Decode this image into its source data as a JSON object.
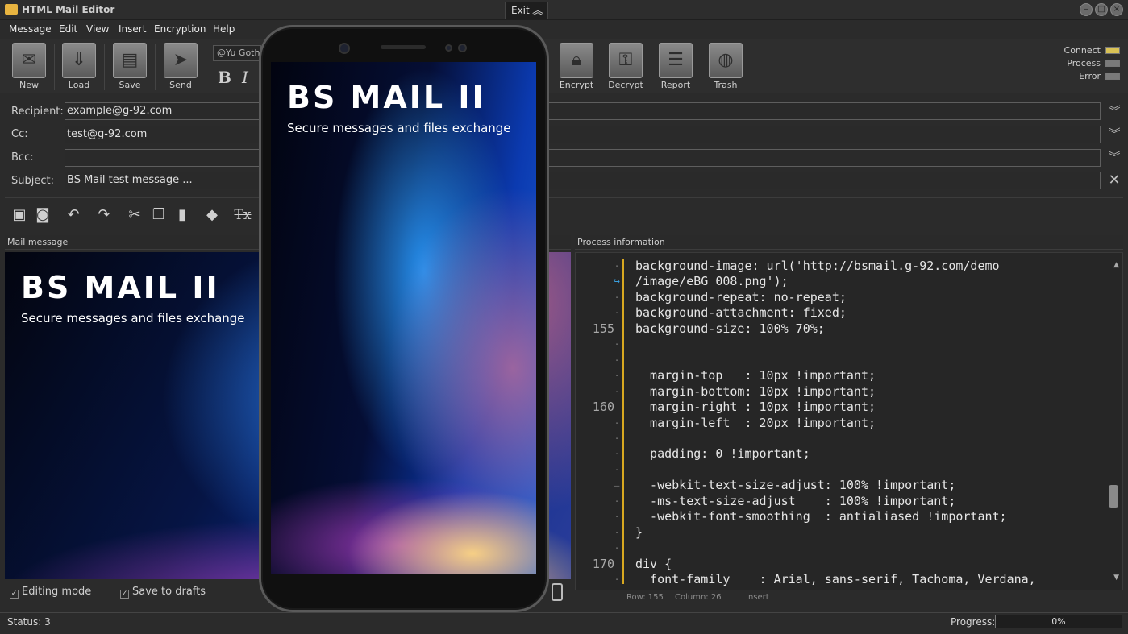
{
  "window": {
    "title": "HTML Mail Editor",
    "exit_label": "Exit"
  },
  "menu": [
    "Message",
    "Edit",
    "View",
    "Insert",
    "Encryption",
    "Help"
  ],
  "toolbar": {
    "buttons_left": [
      {
        "label": "New",
        "icon": "new-mail-icon"
      },
      {
        "label": "Load",
        "icon": "load-icon"
      },
      {
        "label": "Save",
        "icon": "save-icon"
      },
      {
        "label": "Send",
        "icon": "send-icon"
      }
    ],
    "font_name": "@Yu Gothi",
    "bold_label": "B",
    "italic_label": "I",
    "buttons_right": [
      {
        "label": "Encrypt",
        "icon": "lock-icon"
      },
      {
        "label": "Decrypt",
        "icon": "key-icon"
      },
      {
        "label": "Report",
        "icon": "report-icon"
      },
      {
        "label": "Trash",
        "icon": "trash-icon"
      }
    ],
    "status_indicators": [
      {
        "label": "Connect",
        "color": "#d9c255"
      },
      {
        "label": "Process",
        "color": "#7a7a7a"
      },
      {
        "label": "Error",
        "color": "#7a7a7a"
      }
    ]
  },
  "fields": {
    "recipient": {
      "label": "Recipient:",
      "value": "example@g-92.com"
    },
    "cc": {
      "label": "Cc:",
      "value": "test@g-92.com"
    },
    "bcc": {
      "label": "Bcc:",
      "value": ""
    },
    "subject": {
      "label": "Subject:",
      "value": "BS Mail test message ..."
    }
  },
  "edit_toolbar": {
    "clear_format_label": "Tx",
    "icons": [
      "image-icon",
      "attachment-icon",
      "undo-icon",
      "redo-icon",
      "cut-icon",
      "copy-icon",
      "paste-icon",
      "eraser-icon",
      "clear-format-icon"
    ]
  },
  "mail_panel": {
    "header": "Mail message",
    "logo": "BS MAIL II",
    "tagline": "Secure messages and files exchange"
  },
  "process_panel": {
    "header": "Process information",
    "lines": [
      {
        "num": "",
        "mark": "·",
        "text": "background-image: url('http://bsmail.g-92.com/demo"
      },
      {
        "num": "",
        "mark": "↪",
        "text": "/image/eBG_008.png');"
      },
      {
        "num": "",
        "mark": "·",
        "text": "background-repeat: no-repeat;"
      },
      {
        "num": "",
        "mark": "·",
        "text": "background-attachment: fixed;"
      },
      {
        "num": "155",
        "mark": "",
        "text": "background-size: 100% 70%;"
      },
      {
        "num": "",
        "mark": "·",
        "text": ""
      },
      {
        "num": "",
        "mark": "·",
        "text": ""
      },
      {
        "num": "",
        "mark": "·",
        "text": "  margin-top   : 10px !important;"
      },
      {
        "num": "",
        "mark": "·",
        "text": "  margin-bottom: 10px !important;"
      },
      {
        "num": "160",
        "mark": "",
        "text": "  margin-right : 10px !important;"
      },
      {
        "num": "",
        "mark": "·",
        "text": "  margin-left  : 20px !important;"
      },
      {
        "num": "",
        "mark": "·",
        "text": ""
      },
      {
        "num": "",
        "mark": "·",
        "text": "  padding: 0 !important;"
      },
      {
        "num": "",
        "mark": "·",
        "text": ""
      },
      {
        "num": "",
        "mark": "–",
        "text": "  -webkit-text-size-adjust: 100% !important;"
      },
      {
        "num": "",
        "mark": "·",
        "text": "  -ms-text-size-adjust    : 100% !important;"
      },
      {
        "num": "",
        "mark": "·",
        "text": "  -webkit-font-smoothing  : antialiased !important;"
      },
      {
        "num": "",
        "mark": "·",
        "text": "}"
      },
      {
        "num": "",
        "mark": "·",
        "text": ""
      },
      {
        "num": "170",
        "mark": "",
        "text": "div {"
      },
      {
        "num": "",
        "mark": "·",
        "text": "  font-family    : Arial, sans-serif, Tachoma, Verdana,"
      }
    ],
    "status_row": "Row: 155",
    "status_col": "Column: 26",
    "status_mode": "Insert"
  },
  "options": {
    "editing_mode": {
      "label": "Editing mode",
      "checked": true
    },
    "save_to_drafts": {
      "label": "Save to drafts",
      "checked": true
    }
  },
  "statusbar": {
    "status": "Status:  3",
    "progress_label": "Progress:",
    "progress_value": "0%"
  },
  "phone": {
    "logo": "BS MAIL II",
    "tagline": "Secure messages and files exchange"
  }
}
